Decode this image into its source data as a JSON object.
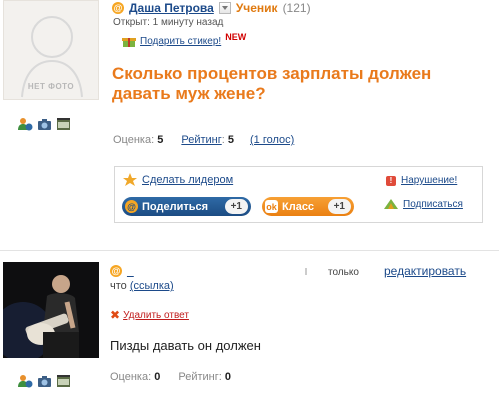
{
  "question": {
    "avatar_placeholder": "НЕТ ФОТО",
    "author": "Даша Петрова",
    "rank": "Ученик",
    "rank_points": "(121)",
    "opened": "Открыт: 1 минуту назад",
    "gift_link": "Подарить стикер!",
    "new_badge": "NEW",
    "title": "Сколько процентов зарплаты должен давать муж жене?",
    "score_label": "Оценка:",
    "score_value": "5",
    "rating_label": "Рейтинг",
    "rating_value": "5",
    "votes": "(1 голос)"
  },
  "actions": {
    "make_leader": "Сделать лидером",
    "violation": "Нарушение!",
    "share": "Поделиться",
    "share_count": "+1",
    "class": "Класс",
    "class_count": "+1",
    "subscribe": "Подписаться"
  },
  "answer": {
    "author": "_",
    "only_label": "только",
    "edit": "редактировать",
    "source_prefix": "что",
    "source_link": "(ссылка)",
    "delete": "Удалить ответ",
    "text": "Пизды давать он должен",
    "score_label": "Оценка:",
    "score_value": "0",
    "rating_label": "Рейтинг:",
    "rating_value": "0"
  },
  "icons": {
    "at": "at-icon",
    "star": "star-icon",
    "warning": "warning-icon",
    "gift": "gift-icon",
    "ok": "ok-icon",
    "subscribe": "subscribe-icon",
    "friend": "add-friend-icon",
    "photo": "photo-icon",
    "video": "video-icon",
    "delete": "delete-x-icon"
  },
  "colors": {
    "title": "#e97a1c",
    "link": "#1c4a8a",
    "share_button": "#1c4c83",
    "class_button": "#ea8012",
    "delete_link": "#c01b1b"
  }
}
